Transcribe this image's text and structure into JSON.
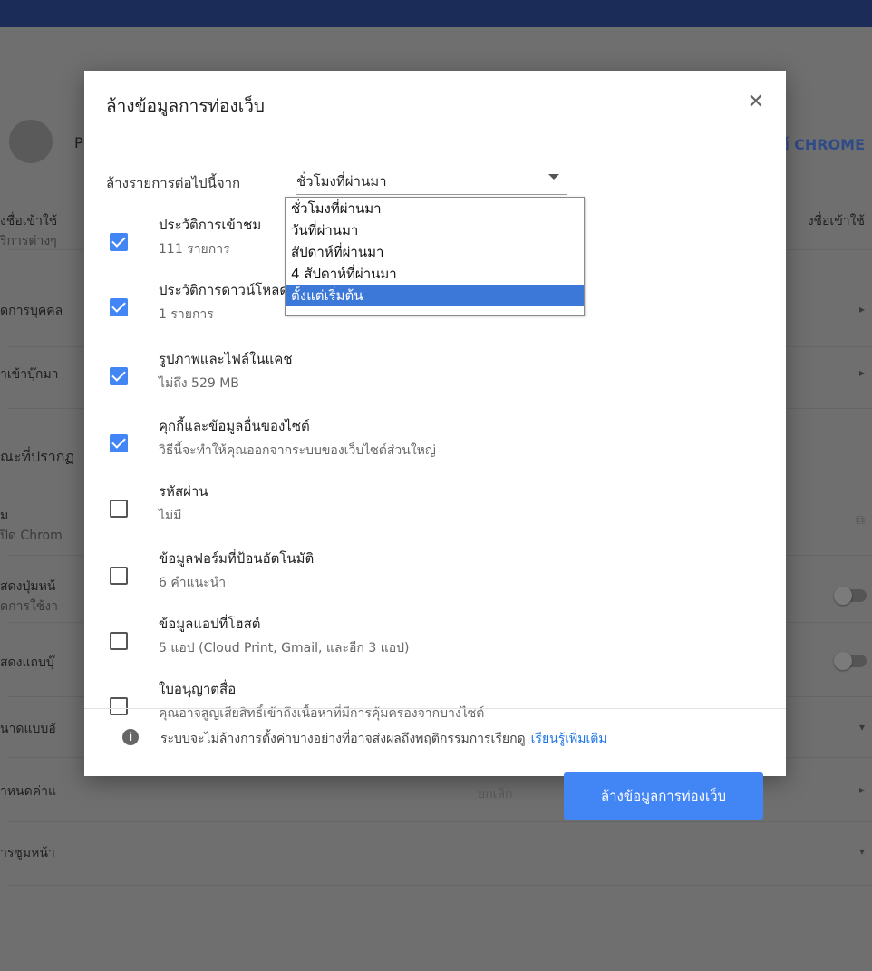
{
  "background": {
    "left_items": [
      "P",
      "งชื่อเข้าใช้",
      "ริการต่างๆ",
      "ดการบุคคล",
      "าเข้าบุ๊กมา",
      "ณะที่ปรากฏ",
      "ม",
      "ปิด Chrom",
      "สดงปุ่มหน้",
      "ดการใช้งา",
      "สดงแถบบุ๊",
      "นาดแบบอั",
      "าหนดค่าแ",
      "ารซูมหน้า"
    ],
    "right_items": [
      "ย์ CHROME",
      "งชื่อเข้าใช้"
    ]
  },
  "dialog": {
    "title": "ล้างข้อมูลการท่องเว็บ",
    "time_range_label": "ล้างรายการต่อไปนี้จาก",
    "time_range_value": "ชั่วโมงที่ผ่านมา",
    "dropdown_options": [
      {
        "label": "ชั่วโมงที่ผ่านมา",
        "selected": false
      },
      {
        "label": "วันที่ผ่านมา",
        "selected": false
      },
      {
        "label": "สัปดาห์ที่ผ่านมา",
        "selected": false
      },
      {
        "label": "4 สัปดาห์ที่ผ่านมา",
        "selected": false
      },
      {
        "label": "ตั้งแต่เริ่มต้น",
        "selected": true
      }
    ],
    "items": [
      {
        "title": "ประวัติการเข้าชม",
        "subtitle": "111 รายการ",
        "checked": true
      },
      {
        "title": "ประวัติการดาวน์โหลด",
        "subtitle": "1 รายการ",
        "checked": true
      },
      {
        "title": "รูปภาพและไฟล์ในแคช",
        "subtitle": "ไม่ถึง 529 MB",
        "checked": true
      },
      {
        "title": "คุกกี้และข้อมูลอื่นของไซต์",
        "subtitle": "วิธีนี้จะทำให้คุณออกจากระบบของเว็บไซต์ส่วนใหญ่",
        "checked": true
      },
      {
        "title": "รหัสผ่าน",
        "subtitle": "ไม่มี",
        "checked": false
      },
      {
        "title": "ข้อมูลฟอร์มที่ป้อนอัตโนมัติ",
        "subtitle": "6 คำแนะนำ",
        "checked": false
      },
      {
        "title": "ข้อมูลแอปที่โฮสต์",
        "subtitle": "5 แอป (Cloud Print, Gmail, และอีก 3 แอป)",
        "checked": false
      },
      {
        "title": "ใบอนุญาตสื่อ",
        "subtitle": "คุณอาจสูญเสียสิทธิ์เข้าถึงเนื้อหาที่มีการคุ้มครองจากบางไซต์",
        "checked": false
      }
    ],
    "cancel_label": "ยกเลิก",
    "clear_label": "ล้างข้อมูลการท่องเว็บ",
    "footer_text": "ระบบจะไม่ล้างการตั้งค่าบางอย่างที่อาจส่งผลถึงพฤติกรรมการเรียกดู",
    "learn_more_label": "เรียนรู้เพิ่มเติม"
  },
  "colors": {
    "accent": "#4285f4",
    "topbar": "#1a2c57"
  }
}
